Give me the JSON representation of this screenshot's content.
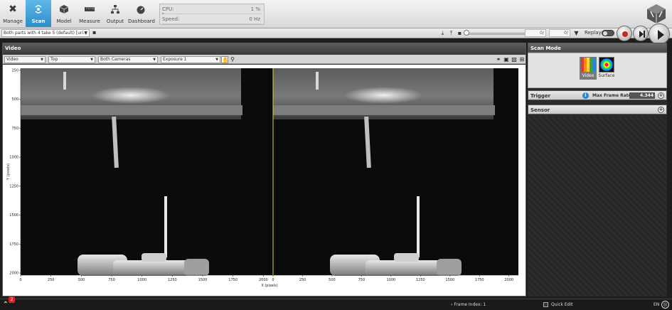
{
  "toolbar": {
    "tools": [
      {
        "label": "Manage",
        "icon": "wrench-screwdriver-icon"
      },
      {
        "label": "Scan",
        "icon": "scan-icon"
      },
      {
        "label": "Model",
        "icon": "cube-icon"
      },
      {
        "label": "Measure",
        "icon": "ruler-icon"
      },
      {
        "label": "Output",
        "icon": "network-icon"
      },
      {
        "label": "Dashboard",
        "icon": "gauge-icon"
      }
    ],
    "active_tool": "Scan",
    "accent_color": "#3a9ad6"
  },
  "stats": {
    "cpu_label": "CPU:",
    "cpu_value": "1 %",
    "cpu_fraction": 0.01,
    "speed_label": "Speed:",
    "speed_value": "0 Hz"
  },
  "jobbar": {
    "job_name": "Both parts with 4 take 5 (default) [uri...",
    "frame_value_1": "0/",
    "frame_value_2": "0/",
    "replay_label": "Replay"
  },
  "video": {
    "title": "Video",
    "view_select": "Video",
    "side_select": "Top",
    "camera_select": "Both Cameras",
    "exposure_select": "Exposure 1",
    "x_axis_label": "X (pixels)",
    "y_axis_label": "Y (pixels)",
    "x_ticks": [
      "0",
      "250",
      "500",
      "750",
      "1000",
      "1250",
      "1500",
      "1750",
      "2000"
    ],
    "y_ticks": [
      "250",
      "500",
      "750",
      "1000",
      "1250",
      "1500",
      "1750",
      "2000"
    ],
    "divider_color": "#d7d72a"
  },
  "sidepanel": {
    "scan_mode_title": "Scan Mode",
    "modes": [
      {
        "label": "Video",
        "selected": true
      },
      {
        "label": "Surface",
        "selected": false
      }
    ],
    "trigger_title": "Trigger",
    "max_frame_rate_label": "Max Frame Rate:",
    "max_frame_rate_value": "4.344",
    "sensor_title": "Sensor"
  },
  "status": {
    "notification_count": "2",
    "frame_index": "Frame Index: 1",
    "quick_edit": "Quick Edit",
    "language": "EN"
  }
}
